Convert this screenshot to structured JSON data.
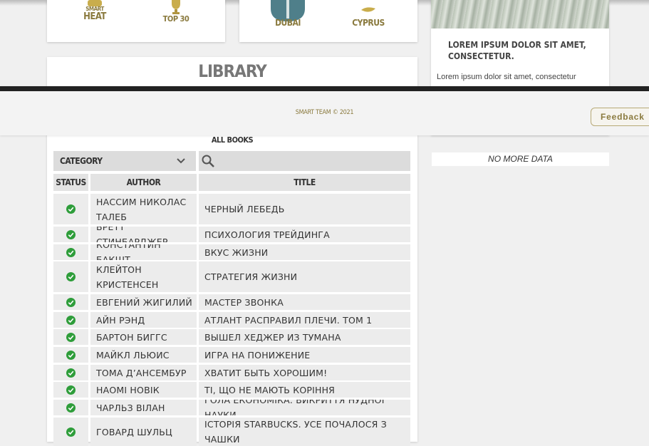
{
  "tiles": {
    "smart_heat_small": "Smart",
    "smart_heat": "Heat",
    "top30": "Top 30",
    "dubai": "Dubai",
    "cyprus": "Cyprus"
  },
  "news": {
    "title": "Lorem ipsum dolor sit amet, consectetur.",
    "text": "Lorem ipsum dolor sit amet, consectetur",
    "no_more": "NO MORE DATA"
  },
  "library": {
    "title": "Library",
    "all_books": "All books",
    "category": "Category",
    "columns": {
      "status": "Status",
      "author": "Author",
      "title": "Title"
    },
    "rows": [
      {
        "author": "Нассим Николас Талеб",
        "title": "Черный лебедь"
      },
      {
        "author": "Бретт Стинбарджер",
        "title": "Психология трейдинга"
      },
      {
        "author": "Константин Бакшт",
        "title": "Вкус жизни"
      },
      {
        "author": "Клейтон Кристенсен",
        "title": "Стратегия жизни"
      },
      {
        "author": "Евгений Жигилий",
        "title": "Мастер звонка"
      },
      {
        "author": "Айн Рэнд",
        "title": "Атлант расправил плечи. Том 1"
      },
      {
        "author": "Бартон Биггс",
        "title": "Вышел хеджер из тумана"
      },
      {
        "author": "Майкл Льюис",
        "title": "Игра на понижение"
      },
      {
        "author": "Тома Д’Ансембур",
        "title": "Хватит быть хорошим!"
      },
      {
        "author": "Наомі Новік",
        "title": "Ті, що не мають коріння"
      },
      {
        "author": "Чарльз Вілан",
        "title": "Гола економіка. Викриття нудної науки"
      },
      {
        "author": "Говард Шульц",
        "title": "Історія Starbucks. Усе почалося з чашки"
      }
    ]
  },
  "footer": {
    "copyright": "Smart Team © 2021",
    "feedback": "Feedback"
  },
  "colors": {
    "accent": "#8a7a3e",
    "status_ok": "#2e9d3a"
  }
}
